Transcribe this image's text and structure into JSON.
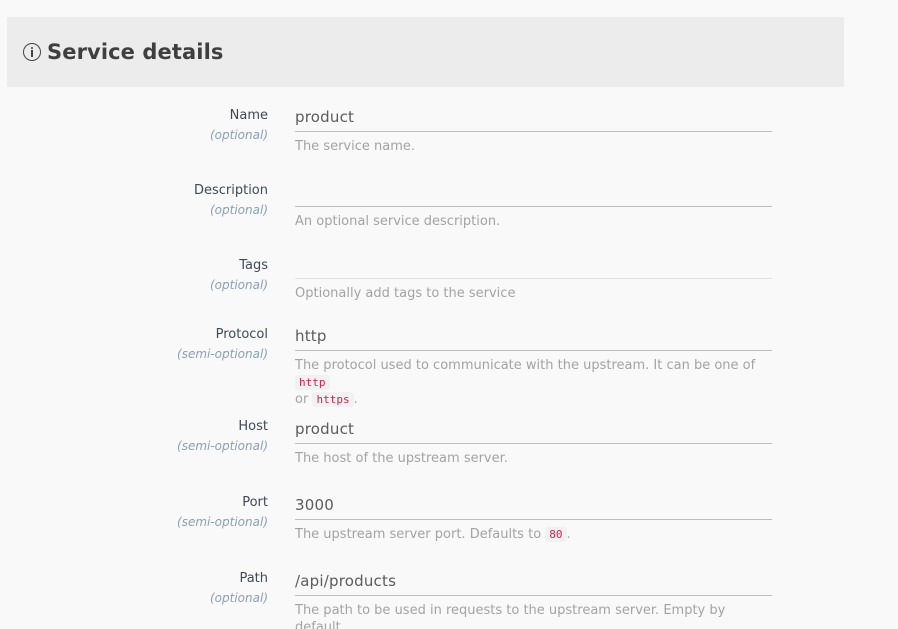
{
  "header": {
    "title": "Service details",
    "icon": "info-circle-icon"
  },
  "fields": {
    "name": {
      "label": "Name",
      "note": "(optional)",
      "value": "product",
      "help": "The service name."
    },
    "description": {
      "label": "Description",
      "note": "(optional)",
      "value": "",
      "help": "An optional service description."
    },
    "tags": {
      "label": "Tags",
      "note": "(optional)",
      "value": "",
      "help": "Optionally add tags to the service"
    },
    "protocol": {
      "label": "Protocol",
      "note": "(semi-optional)",
      "value": "http",
      "help_prefix": "The protocol used to communicate with the upstream. It can be one of",
      "help_code1": "http",
      "help_or": "or",
      "help_code2": "https",
      "help_suffix": "."
    },
    "host": {
      "label": "Host",
      "note": "(semi-optional)",
      "value": "product",
      "help": "The host of the upstream server."
    },
    "port": {
      "label": "Port",
      "note": "(semi-optional)",
      "value": "3000",
      "help_prefix": "The upstream server port. Defaults to",
      "help_code": "80",
      "help_suffix": "."
    },
    "path": {
      "label": "Path",
      "note": "(optional)",
      "value": "/api/products",
      "help": "The path to be used in requests to the upstream server. Empty by default."
    }
  }
}
